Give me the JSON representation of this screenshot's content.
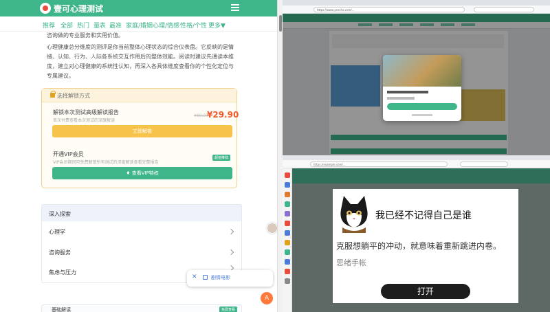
{
  "mobile": {
    "brand": "壹可心理测试",
    "nav": [
      "推荐",
      "全部",
      "热门",
      "量表",
      "最准",
      "家庭/婚姻",
      "心理/情感",
      "性格/个性",
      "更多▼"
    ],
    "intro_line": "咨询做的专业服务和实用价值。",
    "paragraph": "心理健康总分维度的测评是你当前整体心理状态的综合仪表盘。它反映的是情绪、认知、行为、人际各系统交互作用后的整体效能。阅读时建议先通读本维度，建立对心理健康的系统性认知，再深入各具体维度查看你的个性化定位与专属建议。",
    "ellipsis": "...",
    "unlock_title": "选择解锁方式",
    "option1_title": "解锁本次测试高级解读报告",
    "option1_sub": "单次付费查看本次测试的深度解读",
    "price_old": "¥69.00",
    "price": "¥29.90",
    "unlock_btn": "立即解锁",
    "option2_title": "开通VIP会员",
    "option2_sub": "VIP会员期间可免费解锁所有测试的深度解读查看完整报告",
    "option2_badge": "超值推荐",
    "vip_btn": "查看VIP特权",
    "explore_title": "深入探索",
    "explore_items": [
      "心理学",
      "咨询服务",
      "焦虑与压力"
    ],
    "popup_label": "剧情电影",
    "bottom_title": "基础解读",
    "bottom_badge": "免费查看",
    "fab_label": "A"
  },
  "top_right": {
    "url": "https://www.yeecha.com/..."
  },
  "bottom_right": {
    "url": "https://example.com/...",
    "ad_title": "我已经不记得自己是谁",
    "ad_text": "克服想躺平的冲动，就意味着重新跳进内卷。",
    "ad_source": "思绪手帐",
    "ad_button": "打开"
  },
  "colors": {
    "brand_green": "#3fb58a",
    "price_orange": "#ef5a2f",
    "unlock_yellow": "#f8c34a",
    "ad_button": "#1d1d1d"
  }
}
